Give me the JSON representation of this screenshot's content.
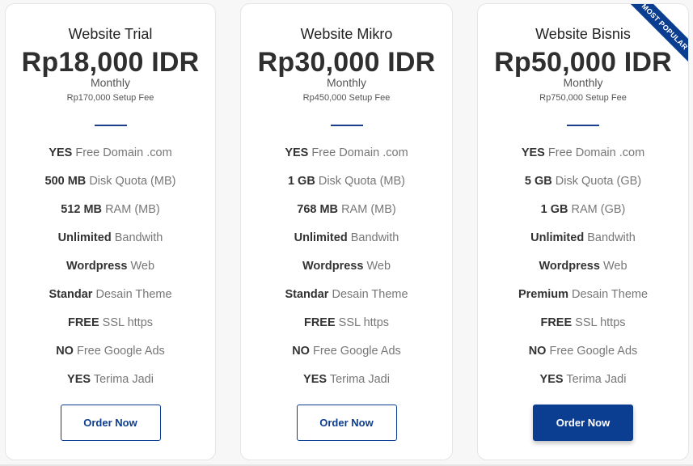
{
  "colors": {
    "accent": "#0b3d91",
    "divider": "#1a3e8c",
    "card_border": "#e3e5e8"
  },
  "plans": [
    {
      "name": "Website Trial",
      "price": "Rp18,000 IDR",
      "period": "Monthly",
      "setup_fee": "Rp170,000 Setup Fee",
      "features": [
        {
          "value": "YES",
          "label": "Free Domain .com"
        },
        {
          "value": "500 MB",
          "label": "Disk Quota (MB)"
        },
        {
          "value": "512 MB",
          "label": "RAM (MB)"
        },
        {
          "value": "Unlimited",
          "label": "Bandwith"
        },
        {
          "value": "Wordpress",
          "label": "Web"
        },
        {
          "value": "Standar",
          "label": "Desain Theme"
        },
        {
          "value": "FREE",
          "label": "SSL https"
        },
        {
          "value": "NO",
          "label": "Free Google Ads"
        },
        {
          "value": "YES",
          "label": "Terima Jadi"
        }
      ],
      "button_label": "Order Now"
    },
    {
      "name": "Website Mikro",
      "price": "Rp30,000 IDR",
      "period": "Monthly",
      "setup_fee": "Rp450,000 Setup Fee",
      "features": [
        {
          "value": "YES",
          "label": "Free Domain .com"
        },
        {
          "value": "1 GB",
          "label": "Disk Quota (MB)"
        },
        {
          "value": "768 MB",
          "label": "RAM (MB)"
        },
        {
          "value": "Unlimited",
          "label": "Bandwith"
        },
        {
          "value": "Wordpress",
          "label": "Web"
        },
        {
          "value": "Standar",
          "label": "Desain Theme"
        },
        {
          "value": "FREE",
          "label": "SSL https"
        },
        {
          "value": "NO",
          "label": "Free Google Ads"
        },
        {
          "value": "YES",
          "label": "Terima Jadi"
        }
      ],
      "button_label": "Order Now"
    },
    {
      "name": "Website Bisnis",
      "price": "Rp50,000 IDR",
      "period": "Monthly",
      "setup_fee": "Rp750,000 Setup Fee",
      "ribbon": "MOST POPULAR",
      "features": [
        {
          "value": "YES",
          "label": "Free Domain .com"
        },
        {
          "value": "5 GB",
          "label": "Disk Quota (GB)"
        },
        {
          "value": "1 GB",
          "label": "RAM (GB)"
        },
        {
          "value": "Unlimited",
          "label": "Bandwith"
        },
        {
          "value": "Wordpress",
          "label": "Web"
        },
        {
          "value": "Premium",
          "label": "Desain Theme"
        },
        {
          "value": "FREE",
          "label": "SSL https"
        },
        {
          "value": "NO",
          "label": "Free Google Ads"
        },
        {
          "value": "YES",
          "label": "Terima Jadi"
        }
      ],
      "button_label": "Order Now"
    }
  ]
}
